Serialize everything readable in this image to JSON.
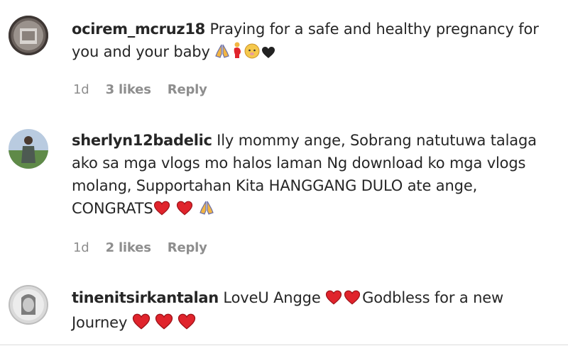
{
  "comments": [
    {
      "username": "ocirem_mcruz18",
      "text_line1": "Praying for a safe and healthy pregnancy for",
      "text_line2": "you and your baby",
      "emojis": [
        "folded-hands-icon",
        "pregnant-woman-icon",
        "baby-icon",
        "black-heart-icon"
      ],
      "time": "1d",
      "likes": "3 likes",
      "reply": "Reply"
    },
    {
      "username": "sherlyn12badelic",
      "text_line1": "Ily mommy ange, Sobrang natutuwa talaga",
      "text_line2": "ako sa mga vlogs mo halos laman Ng download ko mga vlogs",
      "text_line3": "molang, Supportahan Kita HANGGANG DULO ate ange,",
      "text_line4": "CONGRATS",
      "emojis": [
        "red-heart-icon",
        "red-heart-icon",
        "folded-hands-icon"
      ],
      "time": "1d",
      "likes": "2 likes",
      "reply": "Reply"
    },
    {
      "username": "tinenitsirkantalan",
      "text_part1": "LoveU Angge",
      "text_part2": "Godbless for a new",
      "text_line2": "Journey",
      "emojis": [
        "red-heart-icon",
        "red-heart-icon",
        "red-heart-icon",
        "red-heart-icon",
        "red-heart-icon"
      ]
    }
  ],
  "colors": {
    "text": "#262626",
    "meta": "#8e8e8e",
    "heart": "#e0242c",
    "divider": "#dbdbdb"
  }
}
